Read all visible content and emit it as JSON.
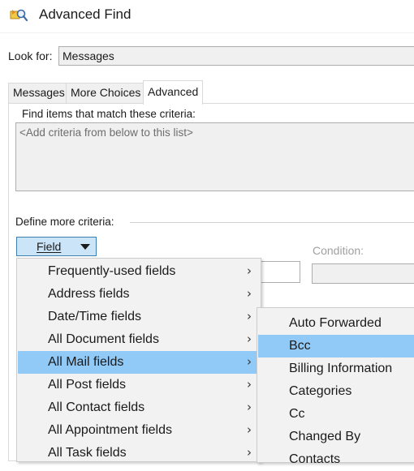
{
  "window": {
    "title": "Advanced Find"
  },
  "look_for": {
    "label": "Look for:",
    "value": "Messages"
  },
  "tabs": [
    {
      "label": "Messages",
      "active": false
    },
    {
      "label": "More Choices",
      "active": false
    },
    {
      "label": "Advanced",
      "active": true
    }
  ],
  "criteria": {
    "label": "Find items that match these criteria:",
    "placeholder": "<Add criteria from below to this list>"
  },
  "define": {
    "label": "Define more criteria:",
    "field_button_label": "Field",
    "condition_label": "Condition:"
  },
  "field_menu": {
    "items": [
      {
        "label": "Frequently-used fields",
        "submenu": true,
        "highlighted": false
      },
      {
        "label": "Address fields",
        "submenu": true,
        "highlighted": false
      },
      {
        "label": "Date/Time fields",
        "submenu": true,
        "highlighted": false
      },
      {
        "label": "All Document fields",
        "submenu": true,
        "highlighted": false
      },
      {
        "label": "All Mail fields",
        "submenu": true,
        "highlighted": true
      },
      {
        "label": "All Post fields",
        "submenu": true,
        "highlighted": false
      },
      {
        "label": "All Contact fields",
        "submenu": true,
        "highlighted": false
      },
      {
        "label": "All Appointment fields",
        "submenu": true,
        "highlighted": false
      },
      {
        "label": "All Task fields",
        "submenu": true,
        "highlighted": false
      }
    ],
    "chevron": "›"
  },
  "mail_submenu": {
    "items": [
      {
        "label": "Auto Forwarded",
        "highlighted": false
      },
      {
        "label": "Bcc",
        "highlighted": true
      },
      {
        "label": "Billing Information",
        "highlighted": false
      },
      {
        "label": "Categories",
        "highlighted": false
      },
      {
        "label": "Cc",
        "highlighted": false
      },
      {
        "label": "Changed By",
        "highlighted": false
      },
      {
        "label": "Contacts",
        "highlighted": false
      }
    ]
  },
  "colors": {
    "highlight": "#91c9f7",
    "field_button_bg": "#cce4f7",
    "field_button_border": "#3c7fb1"
  },
  "icons": {
    "app": "advanced-find-icon",
    "dropdown": "caret-down-icon",
    "submenu": "chevron-right-icon"
  }
}
